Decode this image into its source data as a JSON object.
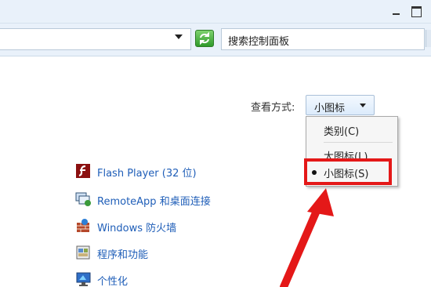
{
  "window": {
    "minimize_label": "",
    "maximize_label": ""
  },
  "address": {
    "search_placeholder": "搜索控制面板"
  },
  "view": {
    "label": "查看方式:",
    "value": "小图标"
  },
  "menu": {
    "items": [
      {
        "label": "类别(C)",
        "selected": false
      },
      {
        "label": "大图标(L)",
        "selected": false
      },
      {
        "label": "小图标(S)",
        "selected": true
      }
    ]
  },
  "control_panel_items": [
    {
      "label": "Flash Player (32 位)",
      "icon": "flash-icon"
    },
    {
      "label": "RemoteApp 和桌面连接",
      "icon": "remoteapp-icon"
    },
    {
      "label": "Windows 防火墙",
      "icon": "firewall-icon"
    },
    {
      "label": "程序和功能",
      "icon": "programs-icon"
    },
    {
      "label": "个性化",
      "icon": "personalization-icon"
    }
  ],
  "colors": {
    "highlight": "#e41818",
    "link": "#1f5eb8",
    "accent_bar": "#e9f1fa"
  }
}
